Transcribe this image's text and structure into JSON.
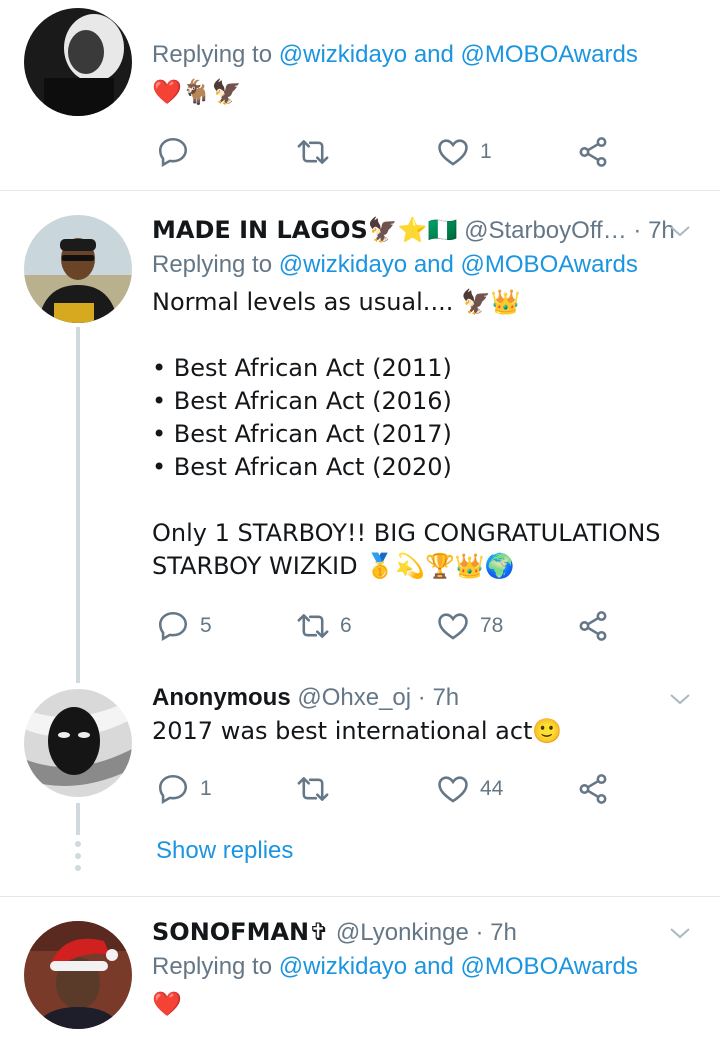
{
  "tweets": [
    {
      "reply_prefix": "Replying to",
      "reply_users": "@wizkidayo and @MOBOAwards",
      "text": "❤️🐐🦅",
      "counts": {
        "reply": "",
        "retweet": "",
        "like": "1"
      }
    },
    {
      "name": "MADE IN LAGOS🦅⭐🇳🇬",
      "handle": "@StarboyOff…",
      "time": "· 7h",
      "reply_prefix": "Replying to",
      "reply_users": "@wizkidayo and @MOBOAwards",
      "text": "Normal levels as usual.... 🦅👑\n\n• Best African Act (2011)\n• Best African Act (2016)\n• Best African Act (2017)\n• Best African Act (2020)\n\nOnly 1 STARBOY!! BIG CONGRATULATIONS\nSTARBOY WIZKID 🥇💫🏆👑🌍",
      "counts": {
        "reply": "5",
        "retweet": "6",
        "like": "78"
      }
    },
    {
      "name": "Anonymous",
      "handle": "@Ohxe_oj",
      "time": "· 7h",
      "text": "2017 was best international act🙂",
      "counts": {
        "reply": "1",
        "retweet": "",
        "like": "44"
      }
    },
    {
      "name": "SONOFMAN✞",
      "handle": "@Lyonkinge",
      "time": "· 7h",
      "reply_prefix": "Replying to",
      "reply_users": "@wizkidayo and @MOBOAwards",
      "text": "❤️"
    }
  ],
  "show_replies": "Show replies",
  "colors": {
    "link": "#1b95e0",
    "secondary": "#657786",
    "divider": "#e1e8ed"
  },
  "icons": [
    "reply-icon",
    "retweet-icon",
    "like-icon",
    "share-icon",
    "caret-down-icon"
  ]
}
